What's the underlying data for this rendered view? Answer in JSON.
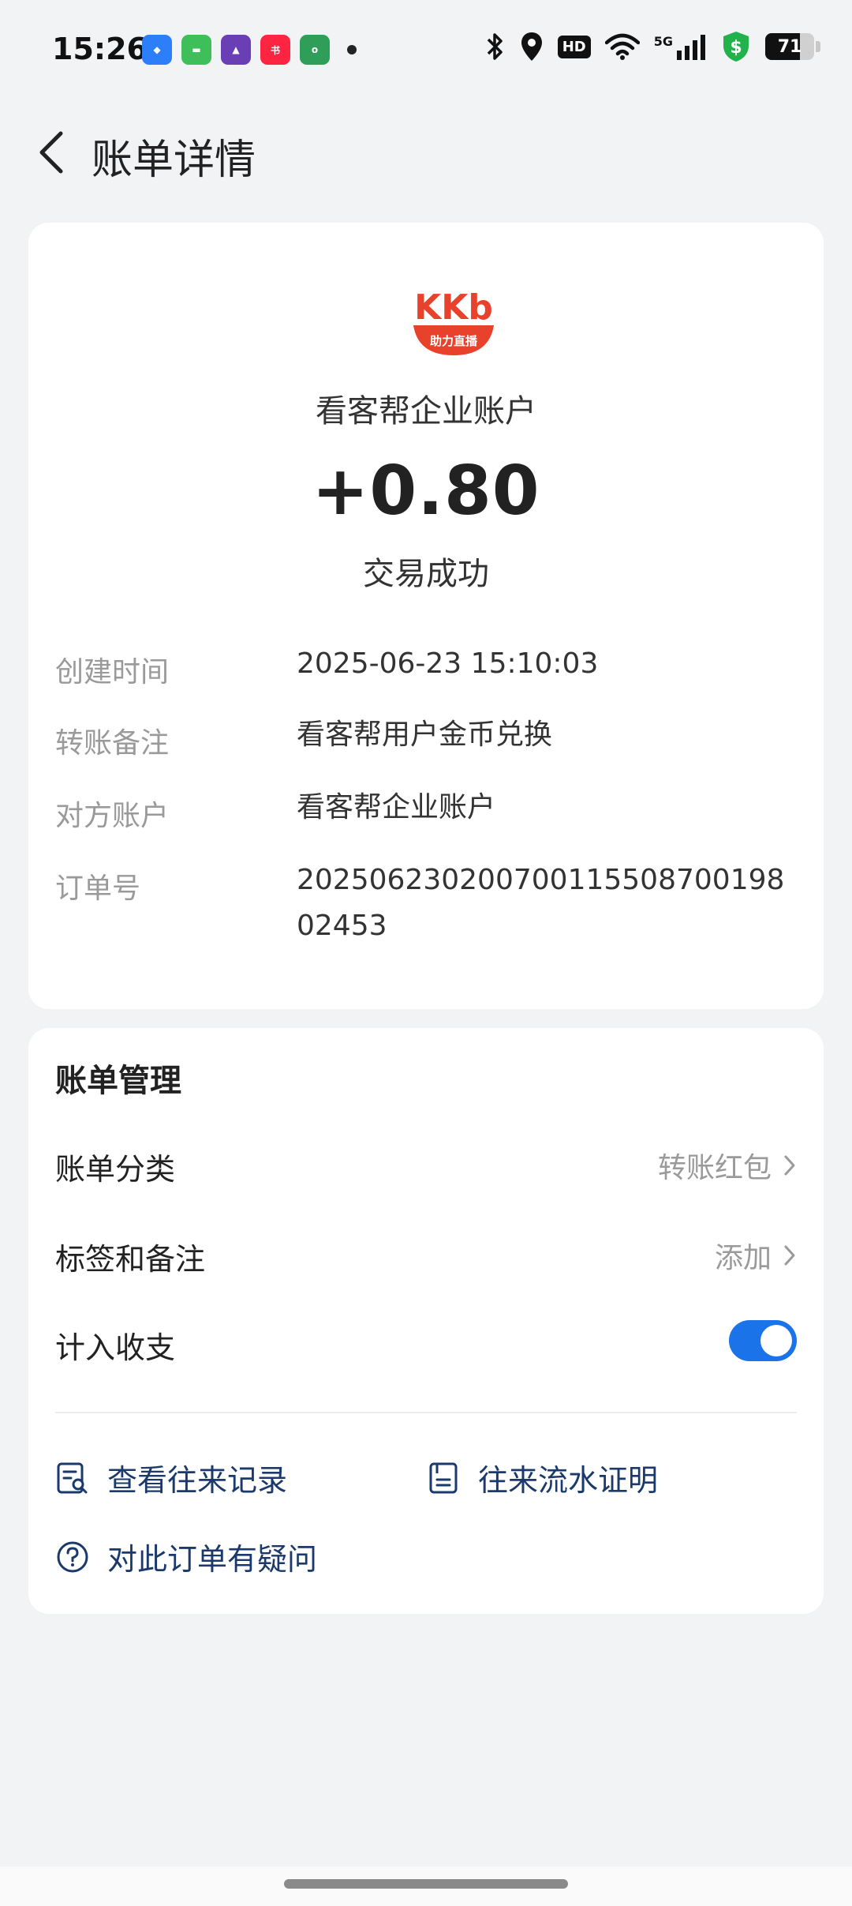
{
  "status_bar": {
    "time": "15:26",
    "hd": "HD",
    "network": "5G",
    "battery": "71",
    "battery_level": 0.71,
    "app_icons": [
      "chat-app-icon",
      "messages-app-icon",
      "video-app-icon",
      "xiaohongshu-app-icon",
      "oppo-app-icon"
    ]
  },
  "header": {
    "title": "账单详情"
  },
  "transaction": {
    "merchant_name": "看客帮企业账户",
    "amount": "+0.80",
    "status": "交易成功",
    "logo_text": "KKb",
    "logo_subtext": "助力直播",
    "details": [
      {
        "label": "创建时间",
        "value": "2025-06-23 15:10:03"
      },
      {
        "label": "转账备注",
        "value": "看客帮用户金币兑换"
      },
      {
        "label": "对方账户",
        "value": "看客帮企业账户"
      },
      {
        "label": "订单号",
        "value": "20250623020070011550870019802453"
      }
    ]
  },
  "management": {
    "title": "账单管理",
    "category_label": "账单分类",
    "category_value": "转账红包",
    "tags_label": "标签和备注",
    "tags_value": "添加",
    "include_label": "计入收支",
    "include_on": true,
    "links": {
      "records": "查看往来记录",
      "proof": "往来流水证明",
      "question": "对此订单有疑问"
    }
  },
  "colors": {
    "accent": "#1a73e8",
    "link": "#1b3a6b",
    "logo_red": "#e8412c",
    "background": "#f2f3f5"
  }
}
